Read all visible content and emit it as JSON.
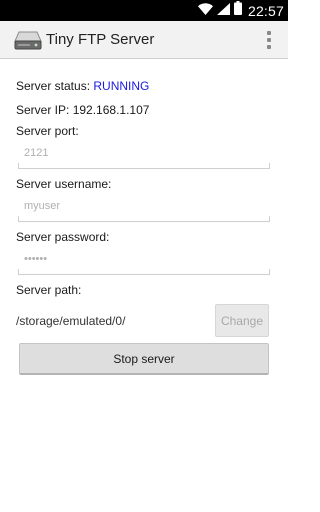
{
  "status_bar": {
    "time": "22:57",
    "icons": [
      "wifi-icon",
      "signal-icon",
      "battery-icon"
    ]
  },
  "action_bar": {
    "title": "Tiny FTP Server",
    "app_icon": "server-icon",
    "menu_icon": "overflow-menu-icon"
  },
  "form": {
    "status_label": "Server status:",
    "status_value": "RUNNING",
    "ip_label": "Server IP:",
    "ip_value": "192.168.1.107",
    "port_label": "Server port:",
    "port_value": "2121",
    "username_label": "Server username:",
    "username_value": "myuser",
    "password_label": "Server password:",
    "password_value": "••••••",
    "path_label": "Server path:",
    "path_value": "/storage/emulated/0/",
    "change_button": "Change",
    "stop_button": "Stop server"
  },
  "colors": {
    "status_running": "#1a1adf",
    "action_bar_bg": "#f2f2f2",
    "button_bg": "#dedede"
  }
}
